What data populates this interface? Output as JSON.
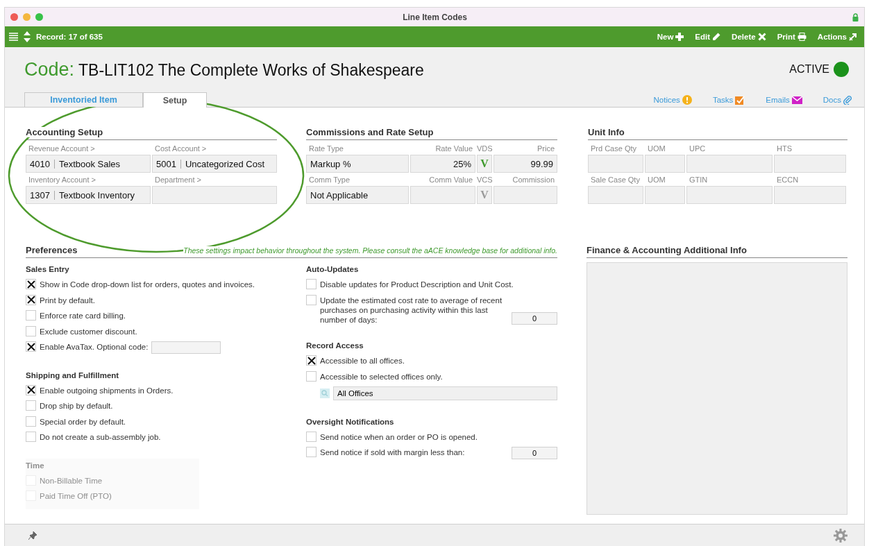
{
  "window": {
    "title": "Line Item Codes"
  },
  "toolbar": {
    "record": "Record: 17 of 635",
    "actions": [
      {
        "label": "New",
        "kind": "new"
      },
      {
        "label": "Edit",
        "kind": "edit"
      },
      {
        "label": "Delete",
        "kind": "delete"
      },
      {
        "label": "Print",
        "kind": "print"
      },
      {
        "label": "Actions",
        "kind": "actions"
      }
    ]
  },
  "header": {
    "prefix": "Code:",
    "title": "TB-LIT102 The Complete Works of Shakespeare",
    "status": "ACTIVE"
  },
  "tabs": [
    {
      "label": "Inventoried Item",
      "selected": false
    },
    {
      "label": "Setup",
      "selected": true
    }
  ],
  "links": [
    {
      "label": "Notices",
      "kind": "notices"
    },
    {
      "label": "Tasks",
      "kind": "tasks"
    },
    {
      "label": "Emails",
      "kind": "emails"
    },
    {
      "label": "Docs",
      "kind": "docs"
    }
  ],
  "accounting": {
    "title": "Accounting Setup",
    "fields": [
      {
        "label": "Revenue Account >",
        "code": "4010",
        "value": "Textbook Sales"
      },
      {
        "label": "Cost Account >",
        "code": "5001",
        "value": "Uncategorized Cost"
      },
      {
        "label": "Inventory Account >",
        "code": "1307",
        "value": "Textbook Inventory"
      },
      {
        "label": "Department >"
      }
    ]
  },
  "commissions": {
    "title": "Commissions and Rate Setup",
    "rows": [
      {
        "cells": [
          {
            "label": "Rate Type",
            "value": "Markup %",
            "kind": "text"
          },
          {
            "label": "Rate Value",
            "value": "25%",
            "kind": "number"
          },
          {
            "label": "VDS",
            "value": "V",
            "kind": "flag",
            "on": true
          },
          {
            "label": "Price",
            "value": "99.99",
            "kind": "number"
          }
        ]
      },
      {
        "cells": [
          {
            "label": "Comm Type",
            "value": "Not Applicable",
            "kind": "text"
          },
          {
            "label": "Comm Value",
            "kind": "number"
          },
          {
            "label": "VCS",
            "value": "V",
            "kind": "flag",
            "on": false
          },
          {
            "label": "Commission",
            "kind": "number"
          }
        ]
      }
    ]
  },
  "unit_info": {
    "title": "Unit Info",
    "rows": [
      {
        "labels": [
          "Prd Case Qty",
          "UOM",
          "UPC",
          "HTS"
        ]
      },
      {
        "labels": [
          "Sale Case Qty",
          "UOM",
          "GTIN",
          "ECCN"
        ]
      }
    ]
  },
  "preferences": {
    "title": "Preferences",
    "note": "These settings impact behavior throughout the system. Please consult the aACE knowledge base for additional info.",
    "columns": [
      {
        "groups": [
          {
            "title": "Sales Entry",
            "disabled": false,
            "items": [
              {
                "kind": "checkbox",
                "label": "Show in Code drop-down list for orders, quotes and invoices.",
                "checked": true
              },
              {
                "kind": "checkbox",
                "label": "Print by default.",
                "checked": true
              },
              {
                "kind": "checkbox",
                "label": "Enforce rate card billing.",
                "checked": false
              },
              {
                "kind": "checkbox",
                "label": "Exclude customer discount.",
                "checked": false
              },
              {
                "kind": "checkbox",
                "label": "Enable AvaTax. Optional code:",
                "checked": true,
                "has_field": true
              }
            ]
          },
          {
            "title": "Shipping and Fulfillment",
            "disabled": false,
            "items": [
              {
                "kind": "checkbox",
                "label": "Enable outgoing shipments in Orders.",
                "checked": true
              },
              {
                "kind": "checkbox",
                "label": "Drop ship by default.",
                "checked": false
              },
              {
                "kind": "checkbox",
                "label": "Special order by default.",
                "checked": false
              },
              {
                "kind": "checkbox",
                "label": "Do not create a sub-assembly job.",
                "checked": false
              }
            ]
          },
          {
            "title": "Time",
            "disabled": true,
            "items": [
              {
                "kind": "checkbox",
                "label": "Non-Billable Time",
                "checked": false
              },
              {
                "kind": "checkbox",
                "label": "Paid Time Off (PTO)",
                "checked": false
              }
            ]
          }
        ]
      },
      {
        "groups": [
          {
            "title": "Auto-Updates",
            "disabled": false,
            "items": [
              {
                "kind": "checkbox",
                "label": "Disable updates for Product Description and Unit Cost.",
                "checked": false
              },
              {
                "kind": "checkbox",
                "label": "Update the estimated cost rate to average of recent purchases on purchasing activity within this last number of days:",
                "checked": false,
                "value": "0"
              }
            ]
          },
          {
            "title": "Record Access",
            "disabled": false,
            "items": [
              {
                "kind": "checkbox",
                "label": "Accessible to all offices.",
                "checked": true
              },
              {
                "kind": "checkbox",
                "label": "Accessible to selected offices only.",
                "checked": false
              },
              {
                "kind": "lookup",
                "value": "All Offices"
              }
            ]
          },
          {
            "title": "Oversight Notifications",
            "disabled": false,
            "items": [
              {
                "kind": "checkbox",
                "label": "Send notice when an order or PO is opened.",
                "checked": false
              },
              {
                "kind": "checkbox",
                "label": "Send notice if sold with margin less than:",
                "checked": false,
                "value": "0"
              }
            ]
          }
        ]
      }
    ]
  },
  "finance": {
    "title": "Finance & Accounting Additional Info"
  }
}
